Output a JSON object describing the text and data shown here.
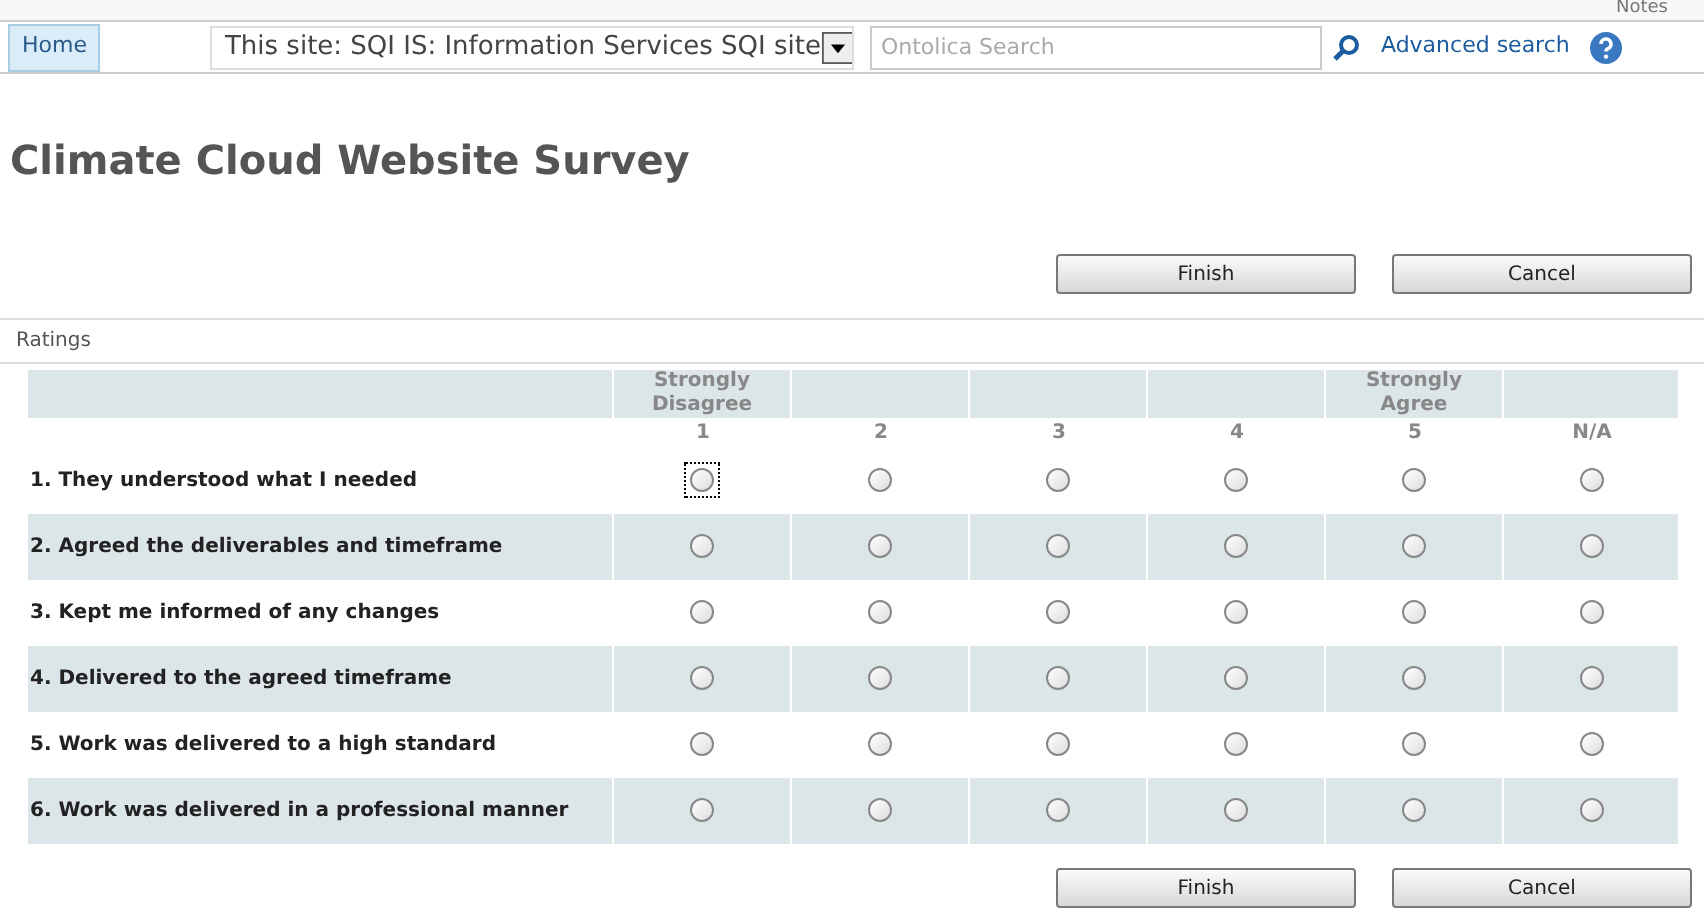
{
  "top_strip": {
    "notes": "Notes"
  },
  "nav": {
    "home": "Home",
    "scope": "This site: SQI IS: Information Services SQI site",
    "search": {
      "placeholder": "Ontolica Search"
    },
    "advanced": "Advanced search"
  },
  "title": "Climate Cloud Website Survey",
  "buttons": [
    "Finish",
    "Cancel"
  ],
  "section": "Ratings",
  "columns": [
    {
      "top": "Strongly Disagree",
      "label": "1"
    },
    {
      "label": "2"
    },
    {
      "label": "3"
    },
    {
      "label": "4"
    },
    {
      "top": "Strongly Agree",
      "label": "5"
    },
    {
      "label": "N/A"
    }
  ],
  "rows": [
    {
      "question": "1. They understood what I needed",
      "radios": [
        {
          "selected": false,
          "focused": true
        },
        {
          "selected": false,
          "focused": false
        },
        {
          "selected": false,
          "focused": false
        },
        {
          "selected": false,
          "focused": false
        },
        {
          "selected": false,
          "focused": false
        },
        {
          "selected": false,
          "focused": false
        }
      ]
    },
    {
      "question": "2. Agreed the deliverables and timeframe",
      "radios": [
        {
          "selected": false,
          "focused": false
        },
        {
          "selected": false,
          "focused": false
        },
        {
          "selected": false,
          "focused": false
        },
        {
          "selected": false,
          "focused": false
        },
        {
          "selected": false,
          "focused": false
        },
        {
          "selected": false,
          "focused": false
        }
      ]
    },
    {
      "question": "3. Kept me informed of any changes",
      "radios": [
        {
          "selected": false,
          "focused": false
        },
        {
          "selected": false,
          "focused": false
        },
        {
          "selected": false,
          "focused": false
        },
        {
          "selected": false,
          "focused": false
        },
        {
          "selected": false,
          "focused": false
        },
        {
          "selected": false,
          "focused": false
        }
      ]
    },
    {
      "question": "4. Delivered to the agreed timeframe",
      "radios": [
        {
          "selected": false,
          "focused": false
        },
        {
          "selected": false,
          "focused": false
        },
        {
          "selected": false,
          "focused": false
        },
        {
          "selected": false,
          "focused": false
        },
        {
          "selected": false,
          "focused": false
        },
        {
          "selected": false,
          "focused": false
        }
      ]
    },
    {
      "question": "5. Work was delivered to a high standard",
      "radios": [
        {
          "selected": false,
          "focused": false
        },
        {
          "selected": false,
          "focused": false
        },
        {
          "selected": false,
          "focused": false
        },
        {
          "selected": false,
          "focused": false
        },
        {
          "selected": false,
          "focused": false
        },
        {
          "selected": false,
          "focused": false
        }
      ]
    },
    {
      "question": "6. Work was delivered in a professional manner",
      "radios": [
        {
          "selected": false,
          "focused": false
        },
        {
          "selected": false,
          "focused": false
        },
        {
          "selected": false,
          "focused": false
        },
        {
          "selected": false,
          "focused": false
        },
        {
          "selected": false,
          "focused": false
        },
        {
          "selected": false,
          "focused": false
        }
      ]
    }
  ],
  "bottom_buttons": [
    "Finish",
    "Cancel"
  ]
}
